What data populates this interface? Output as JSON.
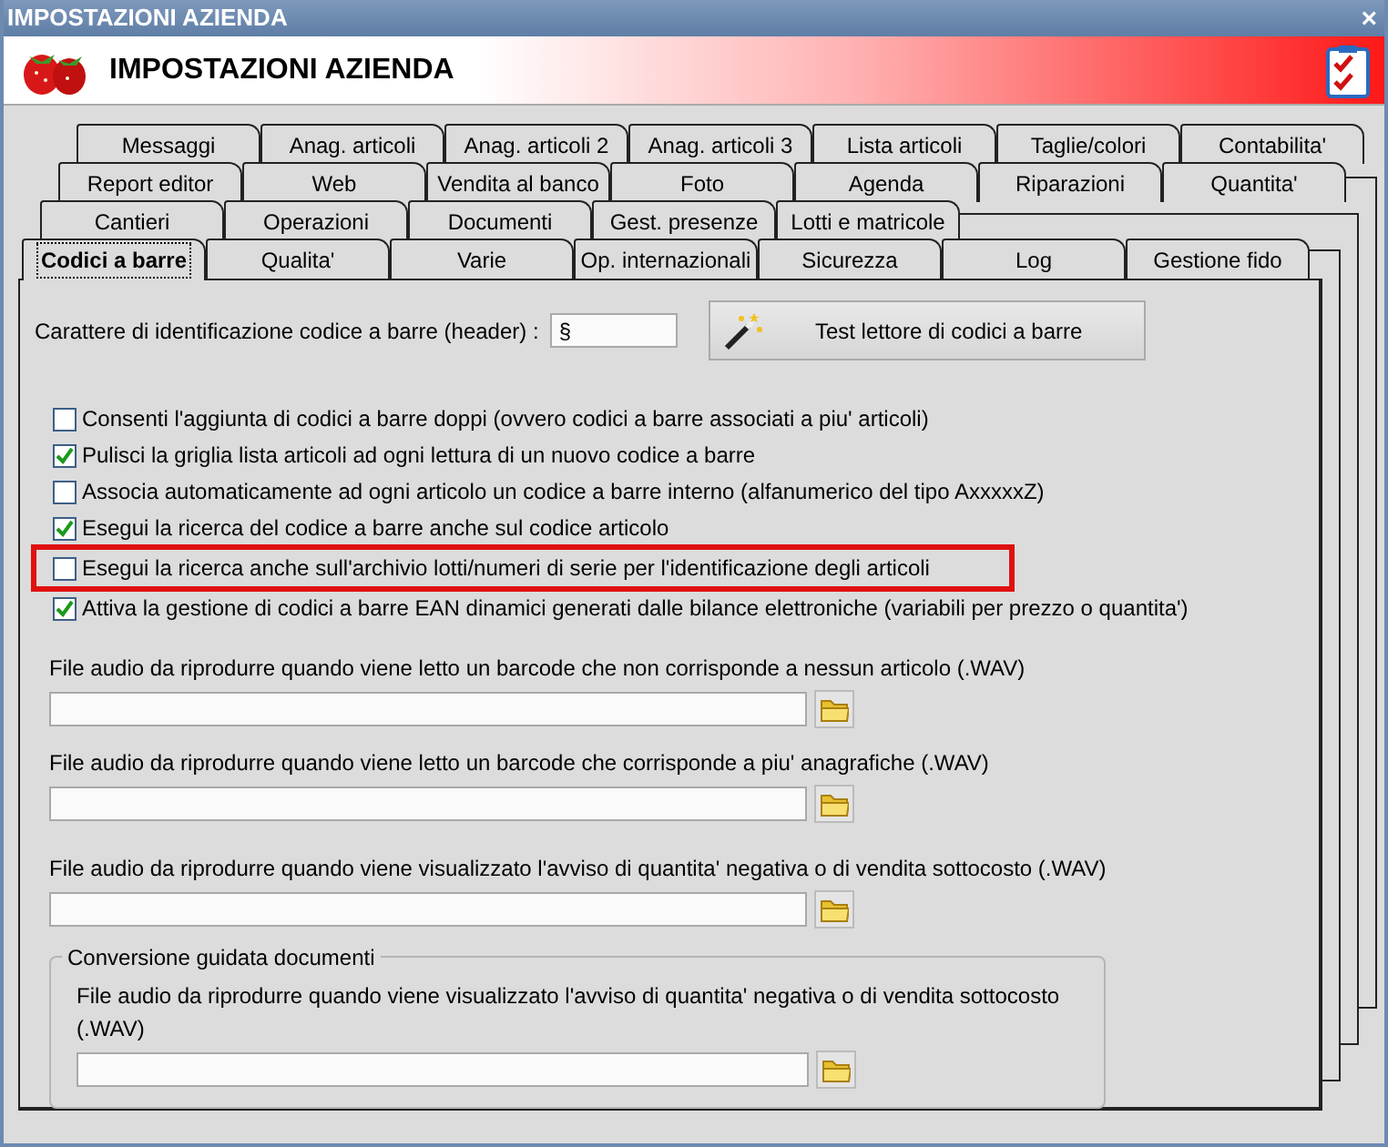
{
  "window": {
    "title": "IMPOSTAZIONI AZIENDA",
    "close": "×"
  },
  "header": {
    "title": "IMPOSTAZIONI AZIENDA"
  },
  "tab_rows": [
    {
      "tabs": [
        {
          "label": "Messaggi",
          "selected": false
        },
        {
          "label": "Anag. articoli",
          "selected": false
        },
        {
          "label": "Anag. articoli 2",
          "selected": false
        },
        {
          "label": "Anag. articoli 3",
          "selected": false
        },
        {
          "label": "Lista articoli",
          "selected": false
        },
        {
          "label": "Taglie/colori",
          "selected": false
        },
        {
          "label": "Contabilita'",
          "selected": false
        }
      ]
    },
    {
      "tabs": [
        {
          "label": "Report editor",
          "selected": false
        },
        {
          "label": "Web",
          "selected": false
        },
        {
          "label": "Vendita al banco",
          "selected": false
        },
        {
          "label": "Foto",
          "selected": false
        },
        {
          "label": "Agenda",
          "selected": false
        },
        {
          "label": "Riparazioni",
          "selected": false
        },
        {
          "label": "Quantita'",
          "selected": false
        }
      ]
    },
    {
      "tabs": [
        {
          "label": "Cantieri",
          "selected": false
        },
        {
          "label": "Operazioni",
          "selected": false
        },
        {
          "label": "Documenti",
          "selected": false
        },
        {
          "label": "Gest. presenze",
          "selected": false
        },
        {
          "label": "Lotti e matricole",
          "selected": false
        }
      ]
    },
    {
      "tabs": [
        {
          "label": "Codici a barre",
          "selected": true
        },
        {
          "label": "Qualita'",
          "selected": false
        },
        {
          "label": "Varie",
          "selected": false
        },
        {
          "label": "Op. internazionali",
          "selected": false
        },
        {
          "label": "Sicurezza",
          "selected": false
        },
        {
          "label": "Log",
          "selected": false
        },
        {
          "label": "Gestione fido",
          "selected": false
        }
      ]
    }
  ],
  "barcode_header": {
    "label": "Carattere di identificazione codice a barre (header) :",
    "value": "§"
  },
  "test_button": {
    "label": "Test lettore di codici a barre"
  },
  "options": [
    {
      "label": "Consenti l'aggiunta di codici a barre doppi (ovvero codici a barre associati a piu' articoli)",
      "checked": false,
      "highlighted": false
    },
    {
      "label": "Pulisci la griglia lista articoli ad ogni lettura di un nuovo codice a barre",
      "checked": true,
      "highlighted": false
    },
    {
      "label": "Associa automaticamente ad ogni articolo un codice a barre interno (alfanumerico del tipo AxxxxxZ)",
      "checked": false,
      "highlighted": false
    },
    {
      "label": "Esegui la ricerca del codice a barre anche sul codice articolo",
      "checked": true,
      "highlighted": false
    },
    {
      "label": "Esegui la ricerca anche sull'archivio lotti/numeri di serie per l'identificazione degli articoli",
      "checked": false,
      "highlighted": true
    },
    {
      "label": "Attiva la gestione di codici a barre EAN dinamici generati dalle bilance elettroniche (variabili per prezzo o quantita')",
      "checked": true,
      "highlighted": false
    }
  ],
  "audio_files": [
    {
      "label": "File audio da riprodurre quando viene letto un barcode che non corrisponde a nessun articolo (.WAV)"
    },
    {
      "label": "File audio da riprodurre quando viene letto un barcode che corrisponde a piu' anagrafiche (.WAV)"
    },
    {
      "label": "File audio da riprodurre quando viene visualizzato l'avviso di quantita' negativa o di vendita sottocosto (.WAV)"
    }
  ],
  "group": {
    "title": "Conversione guidata documenti",
    "audio_files": [
      {
        "label": "File audio da riprodurre quando viene visualizzato l'avviso di quantita' negativa o di vendita sottocosto (.WAV)"
      }
    ]
  }
}
